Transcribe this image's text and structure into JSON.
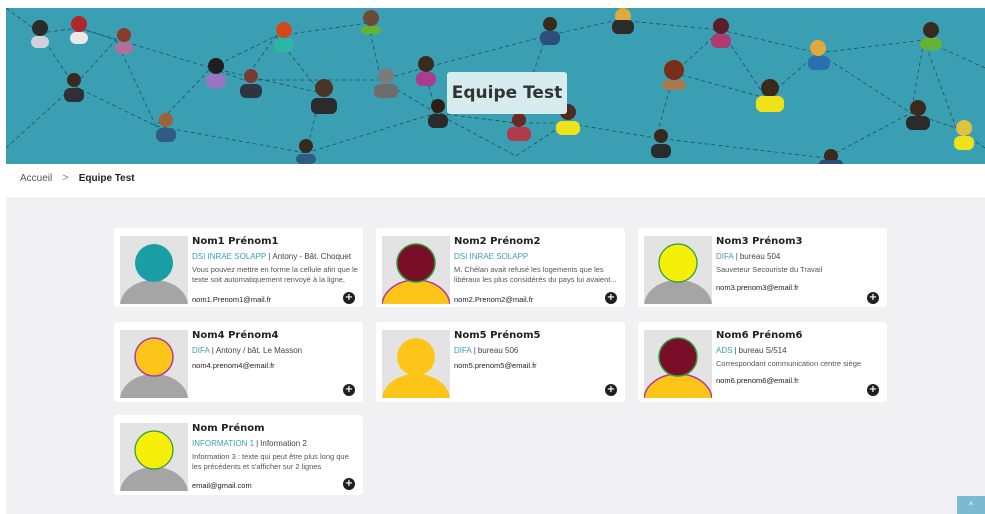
{
  "banner": {
    "title": "Equipe Test"
  },
  "breadcrumb": {
    "home": "Accueil",
    "separator": ">",
    "current": "Equipe Test"
  },
  "colors": {
    "accent": "#3b9fb3",
    "background": "#f1f1f3",
    "teal_avatar": "#1a9ea6",
    "maroon_avatar": "#7a0d27",
    "yellow_avatar": "#f5ef0a",
    "gold_avatar": "#fdc51a",
    "gray_body": "#a5a5a5"
  },
  "cards": [
    {
      "name": "Nom1 Prénom1",
      "org": "DSI INRAE SOLAPP",
      "location": "Antony - Bât. Choquet",
      "description": "Vous pouvez mettre en forme la cellule afin que le texte soit automatiquement renvoyé à la ligne, ou...",
      "email": "nom1.Prenom1@mail.fr",
      "avatar_head": "teal",
      "avatar_body": "gray"
    },
    {
      "name": "Nom2 Prénom2",
      "org": "DSI INRAE SOLAPP",
      "location": "",
      "description": "M. Chélan avait refusé les logements que les libéraux les plus considérés du pays lui avaient...",
      "email": "nom2.Prenom2@mail.fr",
      "avatar_head": "maroon",
      "avatar_body": "gold"
    },
    {
      "name": "Nom3 Prénom3",
      "org": "DIFA",
      "location": "bureau 504",
      "description": "Sauveteur Secouriste du Travail",
      "email": "nom3.prenom3@email.fr",
      "avatar_head": "yellow",
      "avatar_body": "gray"
    },
    {
      "name": "Nom4 Prénom4",
      "org": "DIFA",
      "location": "Antony / bât. Le Masson",
      "description": "",
      "email": "nom4.prenom4@email.fr",
      "avatar_head": "gold",
      "avatar_body": "gray"
    },
    {
      "name": "Nom5 Prénom5",
      "org": "DIFA",
      "location": "bureau 506",
      "description": "",
      "email": "nom5.prenom5@email.fr",
      "avatar_head": "gold",
      "avatar_body": "gold"
    },
    {
      "name": "Nom6 Prénom6",
      "org": "ADS",
      "location": "bureau S/514",
      "description": "Correspondant communication centre siège",
      "email": "nom6.prenom6@email.fr",
      "avatar_head": "maroon",
      "avatar_body": "gold"
    },
    {
      "name": "Nom Prénom",
      "org": "INFORMATION 1",
      "location": "Information 2",
      "description": "Information 3 : texte qui peut être plus long que les précédents et s'afficher sur 2 lignes",
      "email": "email@gmail.com",
      "avatar_head": "yellow",
      "avatar_body": "gray"
    }
  ],
  "scroll_top": {
    "icon": "chevron-up-icon",
    "label": "^"
  }
}
